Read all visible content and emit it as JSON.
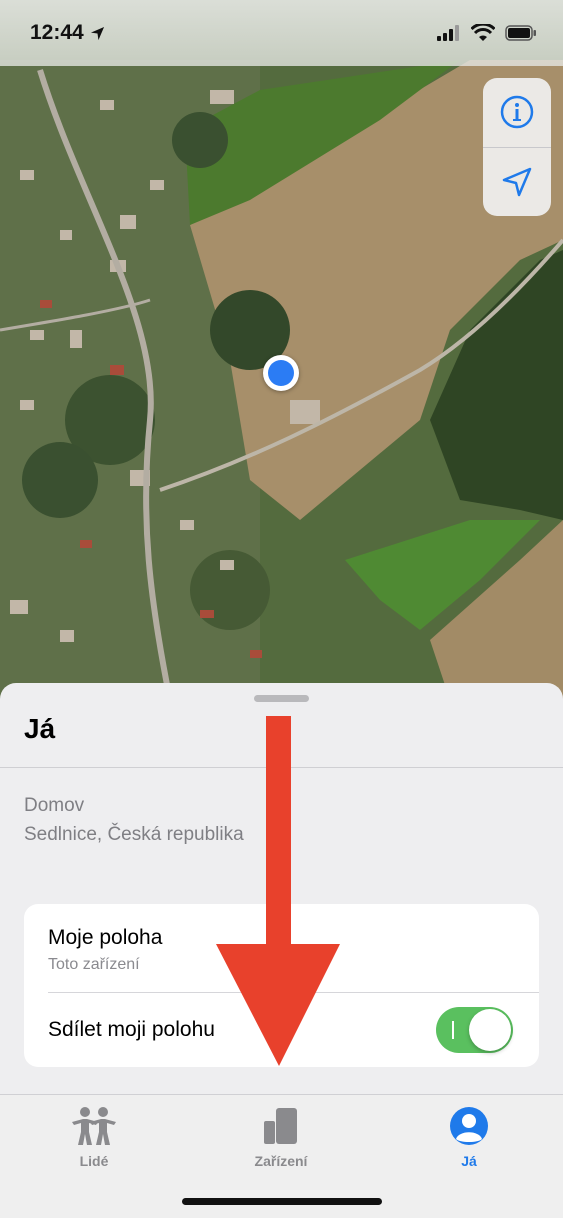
{
  "status_bar": {
    "time": "12:44",
    "location_icon": "location-arrow-icon",
    "signal_icon": "cellular-signal-icon",
    "wifi_icon": "wifi-icon",
    "battery_icon": "battery-icon"
  },
  "map": {
    "controls": {
      "info_icon": "info-icon",
      "location_icon": "location-arrow-icon"
    },
    "user_location_icon": "user-location-dot"
  },
  "sheet": {
    "title": "Já",
    "location_label": "Domov",
    "location_value": "Sedlnice, Česká republika",
    "card": {
      "my_location_title": "Moje poloha",
      "my_location_subtitle": "Toto zařízení",
      "share_location_label": "Sdílet moji polohu",
      "share_location_enabled": true
    }
  },
  "tabbar": {
    "tabs": [
      {
        "label": "Lidé",
        "icon": "people-icon",
        "active": false
      },
      {
        "label": "Zařízení",
        "icon": "devices-icon",
        "active": false
      },
      {
        "label": "Já",
        "icon": "person-icon",
        "active": true
      }
    ]
  },
  "colors": {
    "accent": "#1f7aea",
    "toggle_on": "#5ac05f",
    "annotation_arrow": "#e8412c",
    "inactive_tab": "#8a8a8d"
  }
}
